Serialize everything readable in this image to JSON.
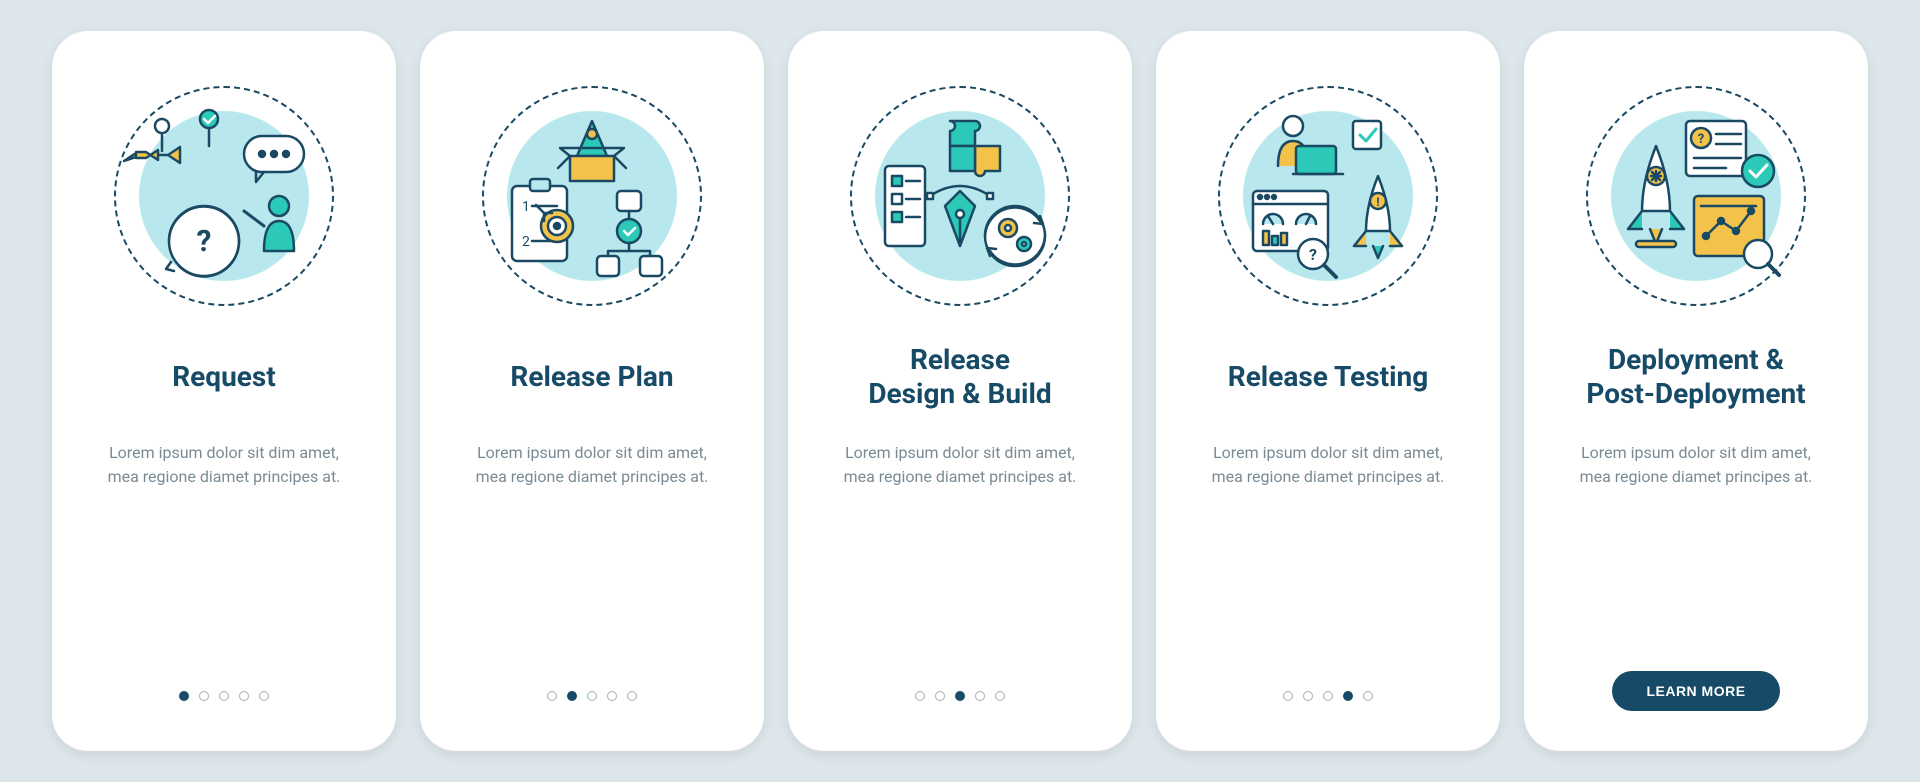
{
  "colors": {
    "bg": "#dde6ea",
    "card": "#ffffff",
    "accent_dark": "#164a66",
    "accent_light": "#b8e8ee",
    "teal": "#2cc9b8",
    "yellow": "#f2c24b",
    "grey_text": "#7a8a94"
  },
  "screens": [
    {
      "id": "request",
      "title": "Request",
      "description": "Lorem ipsum dolor sit dim amet, mea regione diamet principes at.",
      "active_dot": 0,
      "icon": "request-illustration"
    },
    {
      "id": "release-plan",
      "title": "Release Plan",
      "description": "Lorem ipsum dolor sit dim amet, mea regione diamet principes at.",
      "active_dot": 1,
      "icon": "release-plan-illustration"
    },
    {
      "id": "release-design-build",
      "title": "Release\nDesign & Build",
      "description": "Lorem ipsum dolor sit dim amet, mea regione diamet principes at.",
      "active_dot": 2,
      "icon": "design-build-illustration"
    },
    {
      "id": "release-testing",
      "title": "Release Testing",
      "description": "Lorem ipsum dolor sit dim amet, mea regione diamet principes at.",
      "active_dot": 3,
      "icon": "release-testing-illustration"
    },
    {
      "id": "deployment",
      "title": "Deployment &\nPost-Deployment",
      "description": "Lorem ipsum dolor sit dim amet, mea regione diamet principes at.",
      "active_dot": 4,
      "icon": "deployment-illustration",
      "button_label": "LEARN MORE"
    }
  ],
  "dots_count": 5
}
